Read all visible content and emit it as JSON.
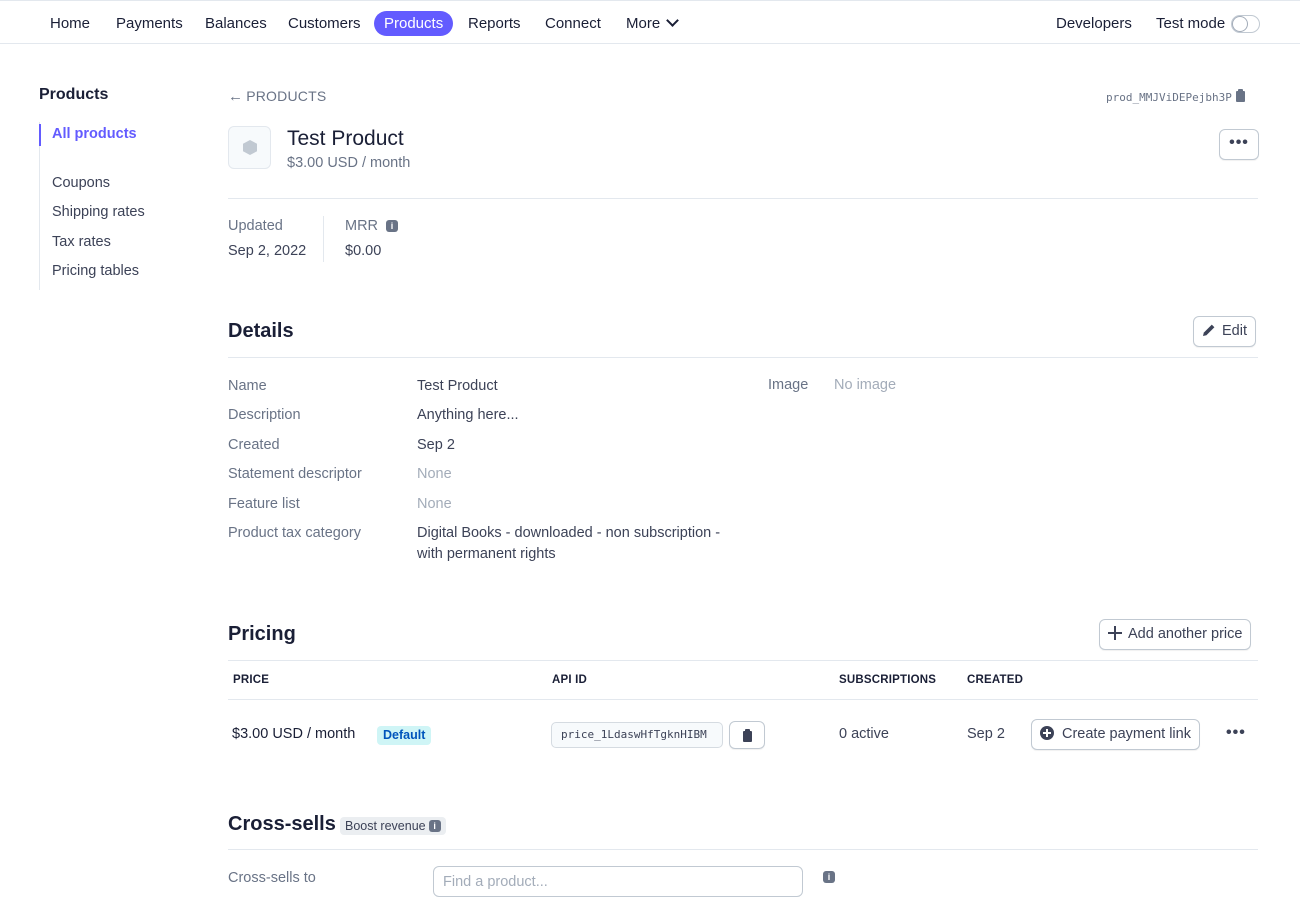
{
  "topnav": {
    "items": [
      "Home",
      "Payments",
      "Balances",
      "Customers",
      "Products",
      "Reports",
      "Connect",
      "More"
    ],
    "developers": "Developers",
    "test_mode": "Test mode",
    "test_mode_on": false,
    "accent": "#635bff"
  },
  "sidebar": {
    "title": "Products",
    "items": [
      "All products",
      "Coupons",
      "Shipping rates",
      "Tax rates",
      "Pricing tables"
    ]
  },
  "header": {
    "breadcrumb": "PRODUCTS",
    "product_id": "prod_MMJViDEPejbh3P",
    "product_name": "Test Product",
    "product_price": "$3.00 USD / month",
    "more_label": "•••"
  },
  "stats": {
    "updated_label": "Updated",
    "updated_value": "Sep 2, 2022",
    "mrr_label": "MRR",
    "mrr_value": "$0.00"
  },
  "details": {
    "title": "Details",
    "edit_label": "Edit",
    "rows": [
      {
        "label": "Name",
        "value": "Test Product"
      },
      {
        "label": "Description",
        "value": "Anything here..."
      },
      {
        "label": "Created",
        "value": "Sep 2"
      },
      {
        "label": "Statement descriptor",
        "value": "None"
      },
      {
        "label": "Feature list",
        "value": "None"
      },
      {
        "label": "Product tax category",
        "value": "Digital Books - downloaded - non subscription - with permanent rights"
      }
    ],
    "image_label": "Image",
    "image_value": "No image"
  },
  "pricing": {
    "title": "Pricing",
    "add_label": "Add another price",
    "columns": [
      "PRICE",
      "API ID",
      "SUBSCRIPTIONS",
      "CREATED"
    ],
    "rows": [
      {
        "price": "$3.00 USD / month",
        "badge": "Default",
        "api_id": "price_1LdaswHfTgknHIBM",
        "subscriptions": "0 active",
        "created": "Sep 2",
        "action": "Create payment link",
        "more": "•••"
      }
    ]
  },
  "crosssells": {
    "title": "Cross-sells",
    "badge": "Boost revenue",
    "label": "Cross-sells to",
    "placeholder": "Find a product..."
  }
}
